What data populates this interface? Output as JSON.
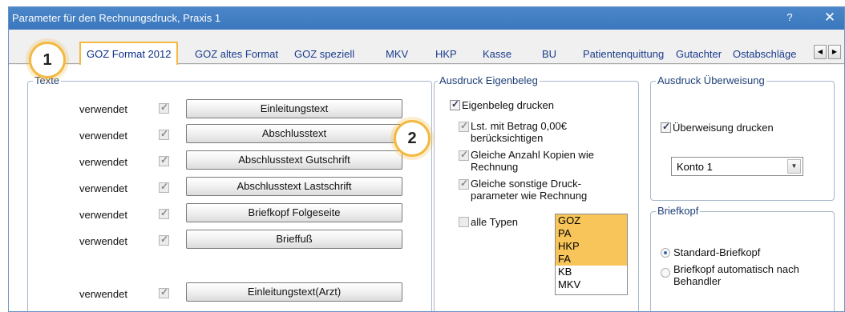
{
  "window": {
    "title": "Parameter für den Rechnungsdruck, Praxis 1",
    "help": "?",
    "close": "✕"
  },
  "tabs": [
    {
      "label": "GOZ Format 2012"
    },
    {
      "label": "GOZ altes Format"
    },
    {
      "label": "GOZ speziell"
    },
    {
      "label": "MKV"
    },
    {
      "label": "HKP"
    },
    {
      "label": "Kasse"
    },
    {
      "label": "BU"
    },
    {
      "label": "Patientenquittung"
    },
    {
      "label": "Gutachter"
    },
    {
      "label": "Ostabschläge"
    }
  ],
  "tab_scroll": {
    "left": "◀",
    "right": "▶"
  },
  "texte": {
    "legend": "Texte",
    "rows": [
      {
        "status": "verwendet",
        "button": "Einleitungstext"
      },
      {
        "status": "verwendet",
        "button": "Abschlusstext"
      },
      {
        "status": "verwendet",
        "button": "Abschlusstext Gutschrift"
      },
      {
        "status": "verwendet",
        "button": "Abschlusstext Lastschrift"
      },
      {
        "status": "verwendet",
        "button": "Briefkopf Folgeseite"
      },
      {
        "status": "verwendet",
        "button": "Brieffuß"
      },
      {
        "status": "verwendet",
        "button": "Einleitungstext(Arzt)"
      }
    ]
  },
  "eigenbeleg": {
    "legend": "Ausdruck Eigenbeleg",
    "drucken": "Eigenbeleg drucken",
    "lst": "Lst. mit Betrag 0,00€ berücksichtigen",
    "kopien": "Gleiche Anzahl Kopien wie Rechnung",
    "sonstige": "Gleiche sonstige Druck-parameter wie Rechnung",
    "alle_typen": "alle Typen",
    "types": [
      "GOZ",
      "PA",
      "HKP",
      "FA",
      "KB",
      "MKV"
    ]
  },
  "ueberweisung": {
    "legend": "Ausdruck Überweisung",
    "drucken": "Überweisung drucken",
    "konto": "Konto 1",
    "arrow": "▼"
  },
  "briefkopf": {
    "legend": "Briefkopf",
    "standard": "Standard-Briefkopf",
    "automatisch": "Briefkopf automatisch nach Behandler"
  },
  "badges": {
    "one": "1",
    "two": "2"
  },
  "colors": {
    "accent": "#f3b941",
    "titlebar": "#3b77bd",
    "selection": "#f7c55a"
  }
}
